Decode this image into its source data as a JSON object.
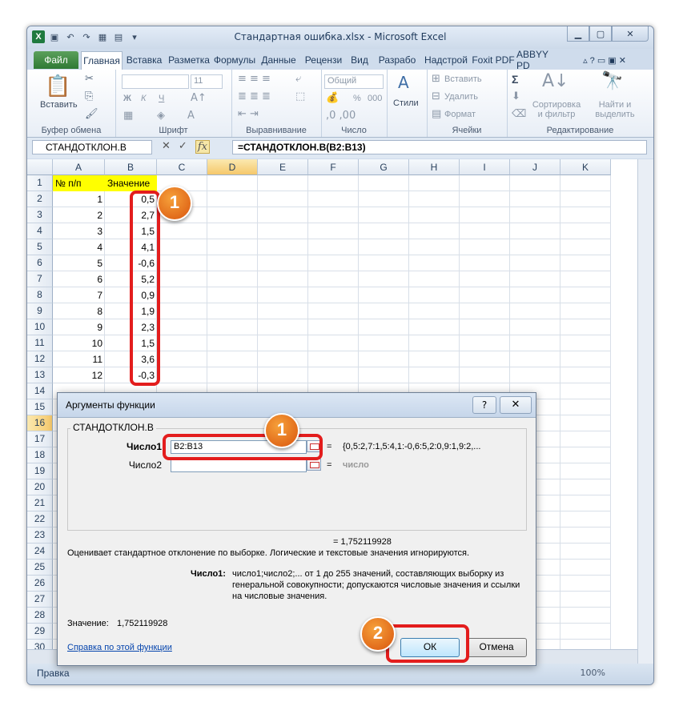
{
  "window": {
    "title": "Стандартная ошибка.xlsx - Microsoft Excel",
    "app_icon": "X"
  },
  "tabs": [
    "Файл",
    "Главная",
    "Вставка",
    "Разметка",
    "Формулы",
    "Данные",
    "Рецензи",
    "Вид",
    "Разрабо",
    "Надстрой",
    "Foxit PDF",
    "ABBYY PD"
  ],
  "ribbon": {
    "groups": [
      "Буфер обмена",
      "Шрифт",
      "Выравнивание",
      "Число",
      "Ячейки",
      "Редактирование"
    ],
    "paste": "Вставить",
    "font_size": "11",
    "bold": "Ж",
    "italic": "К",
    "underline": "Ч",
    "number_format": "Общий",
    "styles": "Стили",
    "insert": "Вставить",
    "delete": "Удалить",
    "format": "Формат",
    "sort": "Сортировка и фильтр",
    "find": "Найти и выделить",
    "sigma": "Σ",
    "percent": "%",
    "thousands": "000"
  },
  "formula_bar": {
    "name_box": "СТАНДОТКЛОН.В",
    "fx": "fx",
    "formula": "=СТАНДОТКЛОН.В(B2:B13)"
  },
  "sheet": {
    "columns": [
      "A",
      "B",
      "C",
      "D",
      "E",
      "F",
      "G",
      "H",
      "I",
      "J",
      "K"
    ],
    "header_row": [
      "№ п/п",
      "Значение"
    ],
    "a_values": [
      "1",
      "2",
      "3",
      "4",
      "5",
      "6",
      "7",
      "8",
      "9",
      "10",
      "11",
      "12"
    ],
    "b_values": [
      "0,5",
      "2,7",
      "1,5",
      "4,1",
      "-0,6",
      "5,2",
      "0,9",
      "1,9",
      "2,3",
      "1,5",
      "3,6",
      "-0,3"
    ],
    "row_numbers": [
      "1",
      "2",
      "3",
      "4",
      "5",
      "6",
      "7",
      "8",
      "9",
      "10",
      "11",
      "12",
      "13",
      "14",
      "15",
      "16",
      "17",
      "18",
      "19",
      "20",
      "21",
      "22",
      "23",
      "24",
      "25",
      "26",
      "27",
      "28",
      "29",
      "30"
    ]
  },
  "status": {
    "mode": "Правка",
    "zoom": "100%"
  },
  "dialog": {
    "title": "Аргументы функции",
    "help": "?",
    "close": "✕",
    "function_name": "СТАНДОТКЛОН.В",
    "arg1_label": "Число1",
    "arg1_value": "B2:B13",
    "arg1_result": "{0,5:2,7:1,5:4,1:-0,6:5,2:0,9:1,9:2,...",
    "arg2_label": "Число2",
    "arg2_result": "число",
    "equals": "=",
    "result_line": "= 1,752119928",
    "description": "Оценивает стандартное отклонение по выборке. Логические и текстовые значения игнорируются.",
    "arg_help_label": "Число1:",
    "arg_help_lines": [
      "число1;число2;... от 1 до 255 значений, составляющих выборку из",
      "генеральной совокупности; допускаются числовые значения и ссылки",
      "на числовые значения."
    ],
    "value_label": "Значение:",
    "value": "1,752119928",
    "help_link": "Справка по этой функции",
    "ok": "ОК",
    "cancel": "Отмена"
  },
  "annotations": {
    "badge1": "1",
    "badge2": "2",
    "color": "#e31d1d"
  }
}
